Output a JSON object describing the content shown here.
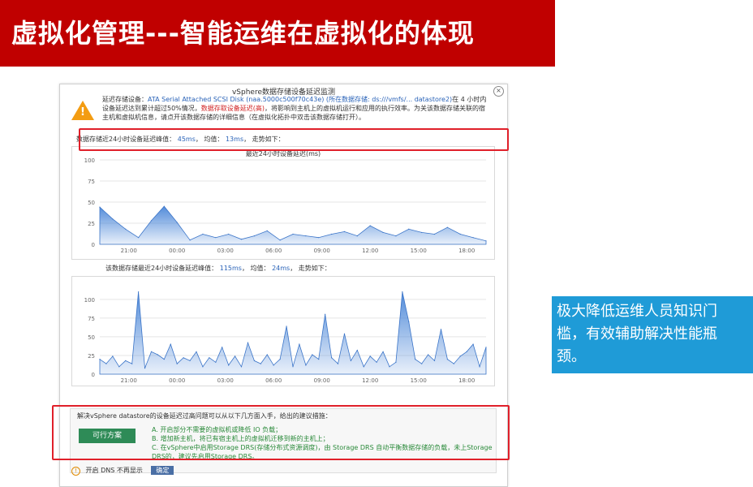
{
  "title": "虚拟化管理---智能运维在虚拟化的体现",
  "dialog": {
    "title": "vSphere数据存储设备延迟监测",
    "close_icon": "×",
    "info_label": "延迟存储设备：",
    "info_device": "ATA Serial Attached SCSI Disk (naa.5000c500f70c43e) (所在数据存储: ds:///vmfs/... datastore2)",
    "info_rest_1": "在 4 小时内设备延迟达到累计超过50%情况，",
    "info_red": "数据存取设备延迟(高)",
    "info_rest_2": "，将影响到主机上的虚拟机运行和应用的执行效率。为关该数据存储关联的宿主机和虚拟机信息，请点开该数据存储的详细信息（在虚拟化拓扑中双击该数据存储打开）。",
    "summary_1_label": "数据存储近24小时设备延迟峰值：",
    "summary_1_peak": "45ms",
    "summary_1_avg_label": "均值：",
    "summary_1_avg": "13ms",
    "summary_1_trend": "走势如下：",
    "chart1_title": "最近24小时设备延迟(ms)",
    "summary_2_label": "该数据存储最近24小时设备延迟峰值：",
    "summary_2_peak": "115ms",
    "summary_2_avg_label": "均值：",
    "summary_2_avg": "24ms",
    "summary_2_trend": "走势如下：",
    "chart2_title": "",
    "suggestion_head": "解决vSphere datastore的设备延迟过高问题可以从以下几方面入手，给出的建议措施：",
    "action_button": "可行方案",
    "opt_a": "A. 开启部分不需要的虚拟机或降低 IO 负载；",
    "opt_b": "B. 增加新主机，将已有宿主机上的虚拟机迁移到新的主机上；",
    "opt_c": "C. 在vSphere中启用Storage DRS(存储分布式资源调度)，由 Storage DRS 自动平衡数据存储的负载，未上Storage DRS的，建议先启用Storage DRS。",
    "footer_text": "开启 DNS 不再显示",
    "footer_button": "确定"
  },
  "callout": "极大降低运维人员知识门槛，有效辅助解决性能瓶颈。",
  "colors": {
    "title_bg": "#c00000",
    "callout_bg": "#1f9bd7",
    "highlight": "#e0202a",
    "chart_fill": "#4a86d8"
  },
  "chart_data": [
    {
      "type": "area",
      "title": "最近24小时设备延迟(ms)",
      "ylim": [
        0,
        100
      ],
      "yticks": [
        0,
        25,
        50,
        75,
        100
      ],
      "xticks": [
        "21:00",
        "00:00",
        "03:00",
        "06:00",
        "09:00",
        "12:00",
        "15:00",
        "18:00"
      ],
      "values": [
        44,
        30,
        18,
        8,
        28,
        45,
        26,
        5,
        12,
        8,
        12,
        6,
        10,
        16,
        5,
        12,
        10,
        8,
        12,
        15,
        10,
        22,
        14,
        10,
        18,
        14,
        12,
        20,
        12,
        8,
        4
      ]
    },
    {
      "type": "area",
      "ylim": [
        0,
        115
      ],
      "yticks": [
        0,
        25,
        50,
        75,
        100
      ],
      "xticks": [
        "21:00",
        "00:00",
        "03:00",
        "06:00",
        "09:00",
        "12:00",
        "15:00",
        "18:00"
      ],
      "values": [
        20,
        14,
        24,
        10,
        18,
        14,
        110,
        8,
        30,
        26,
        20,
        40,
        14,
        22,
        18,
        30,
        10,
        22,
        16,
        36,
        12,
        24,
        10,
        42,
        18,
        14,
        26,
        12,
        20,
        64,
        10,
        40,
        12,
        26,
        20,
        80,
        22,
        14,
        54,
        18,
        32,
        10,
        24,
        16,
        30,
        10,
        16,
        110,
        70,
        20,
        14,
        26,
        18,
        60,
        20,
        14,
        24,
        30,
        40,
        10,
        36
      ]
    }
  ]
}
